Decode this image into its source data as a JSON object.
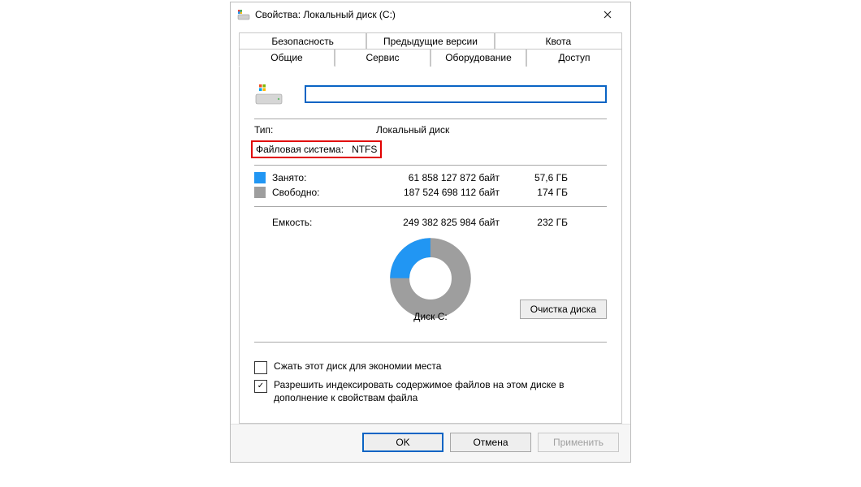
{
  "window": {
    "title": "Свойства: Локальный диск (C:)"
  },
  "tabs_row1": [
    {
      "label": "Безопасность"
    },
    {
      "label": "Предыдущие версии"
    },
    {
      "label": "Квота"
    }
  ],
  "tabs_row2": [
    {
      "label": "Общие",
      "active": true
    },
    {
      "label": "Сервис"
    },
    {
      "label": "Оборудование"
    },
    {
      "label": "Доступ"
    }
  ],
  "name_input": {
    "value": ""
  },
  "type": {
    "label": "Тип:",
    "value": "Локальный диск"
  },
  "fs": {
    "label": "Файловая система:",
    "value": "NTFS"
  },
  "used": {
    "label": "Занято:",
    "bytes": "61 858 127 872 байт",
    "gb": "57,6 ГБ"
  },
  "free": {
    "label": "Свободно:",
    "bytes": "187 524 698 112 байт",
    "gb": "174 ГБ"
  },
  "capacity": {
    "label": "Емкость:",
    "bytes": "249 382 825 984 байт",
    "gb": "232 ГБ"
  },
  "donut": {
    "label": "Диск C:"
  },
  "cleanup_label": "Очистка диска",
  "checkbox_compress": {
    "checked": false,
    "label": "Сжать этот диск для экономии места"
  },
  "checkbox_index": {
    "checked": true,
    "label": "Разрешить индексировать содержимое файлов на этом диске в дополнение к свойствам файла"
  },
  "buttons": {
    "ok": "OK",
    "cancel": "Отмена",
    "apply": "Применить"
  },
  "colors": {
    "used": "#2196f3",
    "free": "#9e9e9e"
  },
  "chart_data": {
    "type": "pie",
    "title": "Диск C:",
    "series": [
      {
        "name": "Занято",
        "value": 61858127872,
        "color": "#2196f3"
      },
      {
        "name": "Свободно",
        "value": 187524698112,
        "color": "#9e9e9e"
      }
    ],
    "total": 249382825984
  }
}
